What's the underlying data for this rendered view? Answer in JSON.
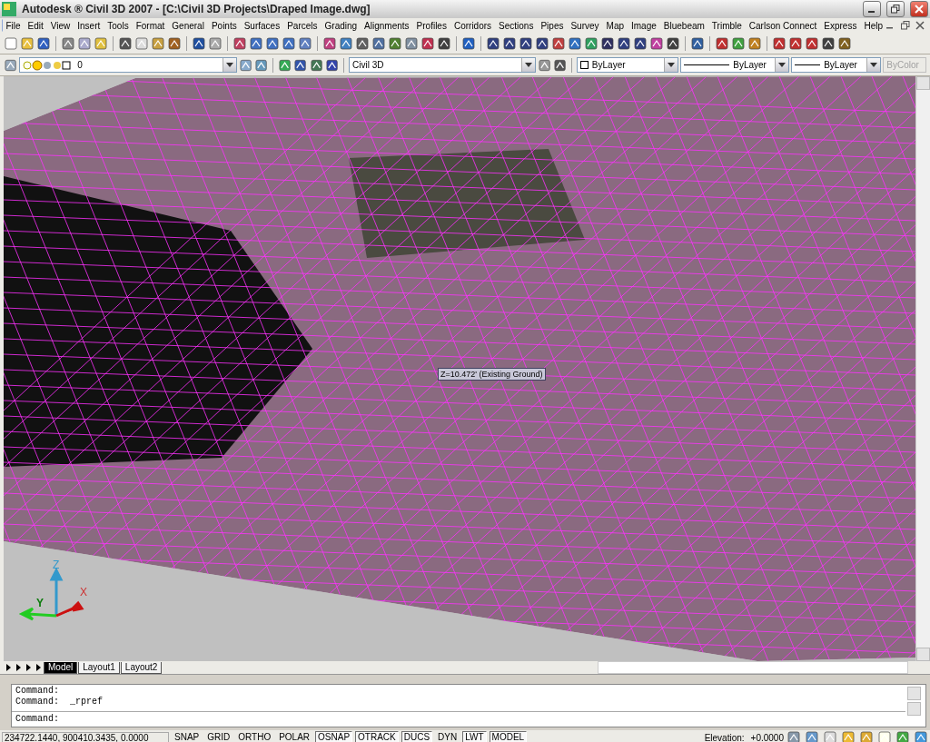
{
  "window": {
    "title": "Autodesk ® Civil 3D 2007 - [C:\\Civil 3D Projects\\Draped Image.dwg]"
  },
  "menu": [
    "File",
    "Edit",
    "View",
    "Insert",
    "Tools",
    "Format",
    "General",
    "Points",
    "Surfaces",
    "Parcels",
    "Grading",
    "Alignments",
    "Profiles",
    "Corridors",
    "Sections",
    "Pipes",
    "Survey",
    "Map",
    "Image",
    "Bluebeam",
    "Trimble",
    "Carlson Connect",
    "Express",
    "Help"
  ],
  "properties_toolbar": {
    "layer": "0",
    "text_style": "Civil 3D",
    "object_color": "ByLayer",
    "linetype": "ByLayer",
    "lineweight": "ByLayer",
    "plot_style": {
      "value": "ByColor",
      "disabled": true
    }
  },
  "viewport": {
    "tooltip": "Z=10.472' (Existing Ground)",
    "ucs_axes": {
      "x": "X",
      "y": "Y",
      "z": "Z"
    }
  },
  "layout_tabs": [
    {
      "label": "Model",
      "selected": true
    },
    {
      "label": "Layout1",
      "selected": false
    },
    {
      "label": "Layout2",
      "selected": false
    }
  ],
  "command_window": {
    "history": [
      "Command:",
      "Command:  _rpref"
    ],
    "prompt": "Command:"
  },
  "status_bar": {
    "coordinates": "234722.1440, 900410.3435, 0.0000",
    "toggles": [
      {
        "label": "SNAP",
        "on": false
      },
      {
        "label": "GRID",
        "on": false
      },
      {
        "label": "ORTHO",
        "on": false
      },
      {
        "label": "POLAR",
        "on": false
      },
      {
        "label": "OSNAP",
        "on": true
      },
      {
        "label": "OTRACK",
        "on": true
      },
      {
        "label": "DUCS",
        "on": true
      },
      {
        "label": "DYN",
        "on": false
      },
      {
        "label": "LWT",
        "on": true
      },
      {
        "label": "MODEL",
        "on": true
      }
    ],
    "elevation_label": "Elevation:",
    "elevation": "+0.0000"
  }
}
